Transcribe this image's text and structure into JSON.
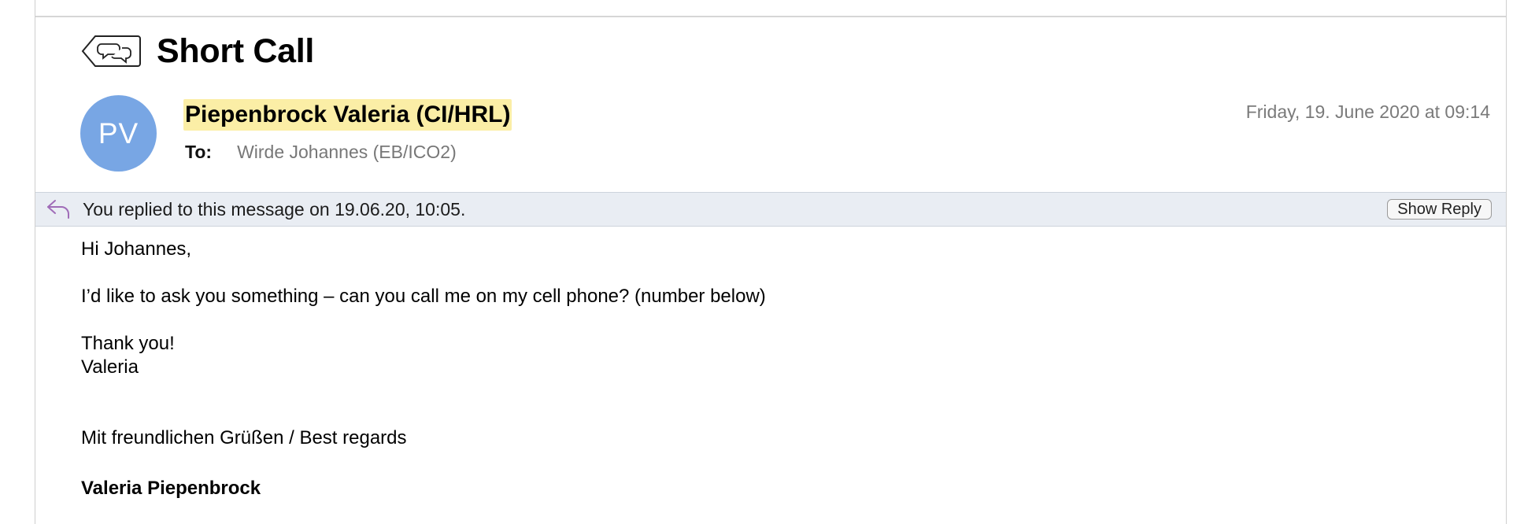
{
  "message": {
    "subject": "Short Call",
    "sender": {
      "initials": "PV",
      "name": "Piepenbrock Valeria (CI/HRL)",
      "avatar_color": "#78a6e4",
      "highlight_color": "#fbeea6"
    },
    "to_label": "To:",
    "to_value": "Wirde Johannes (EB/ICO2)",
    "date": "Friday, 19. June 2020 at 09:14"
  },
  "reply_banner": {
    "icon": "reply-arrow-icon",
    "text": "You replied to this message on 19.06.20, 10:05.",
    "button_label": "Show Reply"
  },
  "body": {
    "greeting": "Hi Johannes,",
    "line1": "I’d like to ask you something – can you call me on my cell phone? (number below)",
    "thanks": "Thank you!",
    "sign": "Valeria",
    "regards": "Mit freundlichen Grüßen / Best regards",
    "full_name": "Valeria Piepenbrock"
  },
  "icons": {
    "subject_icon": "conversation-tag-icon"
  }
}
